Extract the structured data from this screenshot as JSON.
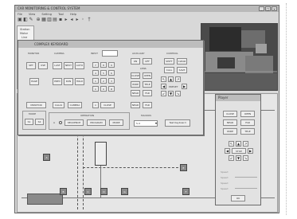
{
  "app": {
    "title": "CAR MONITORING & CONTROL SYSTEM",
    "win_buttons": [
      "_",
      "□",
      "×"
    ]
  },
  "menu": [
    "File",
    "View",
    "Setting",
    "Tool",
    "Help"
  ],
  "toolbar": {
    "icons": [
      "save-icon",
      "open-icon",
      "edit-icon",
      "zoom-icon",
      "grid-icon",
      "chart-icon",
      "print-icon",
      "camera-icon",
      "play-icon",
      "prev-icon",
      "next-icon",
      "stop-icon",
      "help-icon"
    ]
  },
  "left_panel": {
    "items": [
      "Station",
      "Motor",
      "Line"
    ]
  },
  "dialog": {
    "title": "COMPLEX KEYBOARD",
    "monitor_label": "MONITOR",
    "camera_label": "CAMERA",
    "input_label": "INPUT",
    "auxiliary_label": "AUXILIARY",
    "control_label": "CONTROL",
    "lens_label": "LENS",
    "preset_label": "PRESET",
    "mode_label": "MODE",
    "operation_label": "OPERATION",
    "macros_label": "MACROS",
    "monitor_buttons": [
      "SET",
      "USE"
    ],
    "camera_buttons": [
      "LAST",
      "NEXT",
      "AUTO"
    ],
    "menu_buttons": [
      "PAGE",
      "PREV",
      "RUN",
      "HOLD"
    ],
    "keypad": [
      "7",
      "8",
      "9",
      "4",
      "5",
      "6",
      "1",
      "2",
      "3",
      "C",
      "0",
      "#"
    ],
    "aux_buttons": [
      "ON",
      "OFF",
      "CLOSE",
      "OPEN",
      "WIDE",
      "TELE",
      "NEAR",
      "FAR"
    ],
    "control_buttons": [
      "SHIFT",
      "CLEAR",
      "CALL",
      "SAVE"
    ],
    "bottom_buttons": [
      "MONITOR",
      "CALLS",
      "CAMERA"
    ],
    "mode_buttons": [
      "S1",
      "S2"
    ],
    "op_buttons": [
      "SEQUENCE",
      "PROGRAM",
      "MORE"
    ],
    "macro_select": "S-4",
    "test_button": "Test Keyboard",
    "radio_label": "A"
  },
  "small_panel": {
    "title": "Player",
    "buttons": [
      "CLOSE",
      "OPEN",
      "NEAR",
      "FAR",
      "WIDE",
      "TELE"
    ],
    "center_label": "STOP",
    "option_labels": [
      "Speed",
      "Speed",
      "Speed",
      "Speed"
    ],
    "ok_button": "OK"
  },
  "plan": {
    "devices": [
      "A",
      "B",
      "C",
      "D",
      "E",
      "F",
      "G"
    ]
  }
}
